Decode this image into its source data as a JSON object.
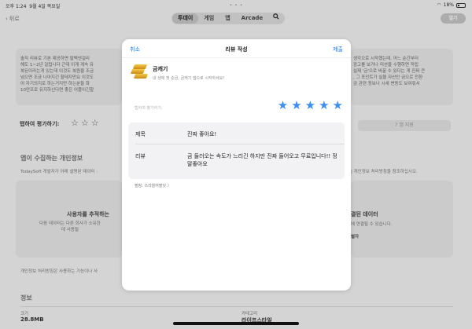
{
  "status": {
    "time": "오후 1:24",
    "date": "9월 4일 목요일",
    "battery": "18%"
  },
  "nav": {
    "back_label": "뒤로",
    "tabs": [
      {
        "label": "투데이",
        "active": true
      },
      {
        "label": "게임",
        "active": false
      },
      {
        "label": "앱",
        "active": false
      },
      {
        "label": "Arcade",
        "active": false
      }
    ],
    "search_icon": "search-icon",
    "open_label": "열기"
  },
  "background": {
    "left_card_text": "솔직 리뷰로 기본 제공하면 떨백넨걸리\n해도 1~2년 걸립니다 근데 이게 계속 유\n복된이라는게 있는데 이것도 복원을 조금\n넘으면 조금 나아지긴 할테지만요 이것도\n어 자기의지로 하는거지만 하는분들 화\n10만프로 유지하신다면 좋은 어플이긴할",
    "right_card_text": "생각으로 시작했는데, 어느 순간부터\n광고를 보거나 미션을 수행하면 적립\n실제 '금'으로 바꿀 수 있다는 게 진짜 큰\n, 그 포인트가 실물 자산인 금으로 전환\n금 관련 정보나 시세 변동도 보여줘서",
    "tap_rate_label": "탭하여 평가하기:",
    "support_label": "앱 지원",
    "privacy_heading": "앱이 수집하는 개인정보",
    "privacy_sub_left": "TodaySoft 개발자가 아래 설명된 데이터 :",
    "privacy_sub_right": "| 개인정보 처리방침을 참조하십시오.",
    "tracking_heading": "사용자를 추적하는",
    "tracking_text": "다음 데이터는 다른 회사가 소유한\n데 사용될",
    "linked_heading": "결된 데이터",
    "linked_text": "에 연결될 수 있습니다.",
    "linked_small": "별자",
    "policy_text": "개인정보 처리방침은 사용하는 기능이나 사",
    "info_heading": "정보",
    "size_label": "크기",
    "size_value": "28.8MB",
    "category_label": "카테고리",
    "category_value": "라이프스타일"
  },
  "modal": {
    "cancel_label": "취소",
    "title": "리뷰 작성",
    "submit_label": "제출",
    "app_name": "금캐기",
    "app_subtitle": "내 생애 첫 순금, 금캐기 앱으로 시작하세요!",
    "rate_placeholder": "탭하여 평가하기:",
    "rating": 5,
    "rating_max": 5,
    "star_color": "#3b8ff0",
    "title_label": "제목",
    "title_value": "진짜 좋아요!",
    "review_label": "리뷰",
    "review_value": "금 들러오는 속도가 느리긴 하지만 진짜 들어오고 무료입니다!! 정말좋아요",
    "hint": "팔팡: 쓰라칠여팔닷 〉"
  }
}
